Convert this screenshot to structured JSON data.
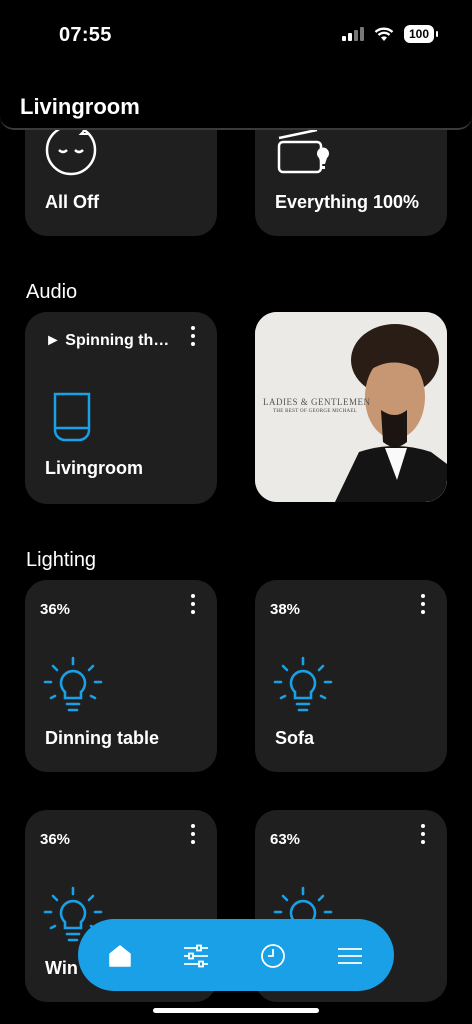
{
  "status": {
    "time": "07:55",
    "battery": "100"
  },
  "header": {
    "title": "Livingroom"
  },
  "scenes": [
    {
      "label": "All Off",
      "icon": "sleep-face-icon"
    },
    {
      "label": "Everything 100%",
      "icon": "light-scene-icon"
    }
  ],
  "audio": {
    "section_title": "Audio",
    "now_playing": "► Spinning th…",
    "device_label": "Livingroom",
    "device_icon": "speaker-icon",
    "album": {
      "title": "LADIES & GENTLEMEN",
      "subtitle": "THE BEST OF GEORGE MICHAEL"
    }
  },
  "lighting": {
    "section_title": "Lighting",
    "lights": [
      {
        "label": "Dinning table",
        "level": "36%",
        "icon": "bulb-icon"
      },
      {
        "label": "Sofa",
        "level": "38%",
        "icon": "bulb-icon"
      },
      {
        "label": "Win",
        "level": "36%",
        "icon": "bulb-icon"
      },
      {
        "label": "",
        "level": "63%",
        "icon": "bulb-icon"
      }
    ]
  },
  "tabbar": {
    "tabs": [
      "home-icon",
      "sliders-icon",
      "clock-icon",
      "menu-icon"
    ],
    "color": "#1aa0e6"
  },
  "colors": {
    "accent": "#1aa0e6",
    "card": "#1f1f1f"
  }
}
